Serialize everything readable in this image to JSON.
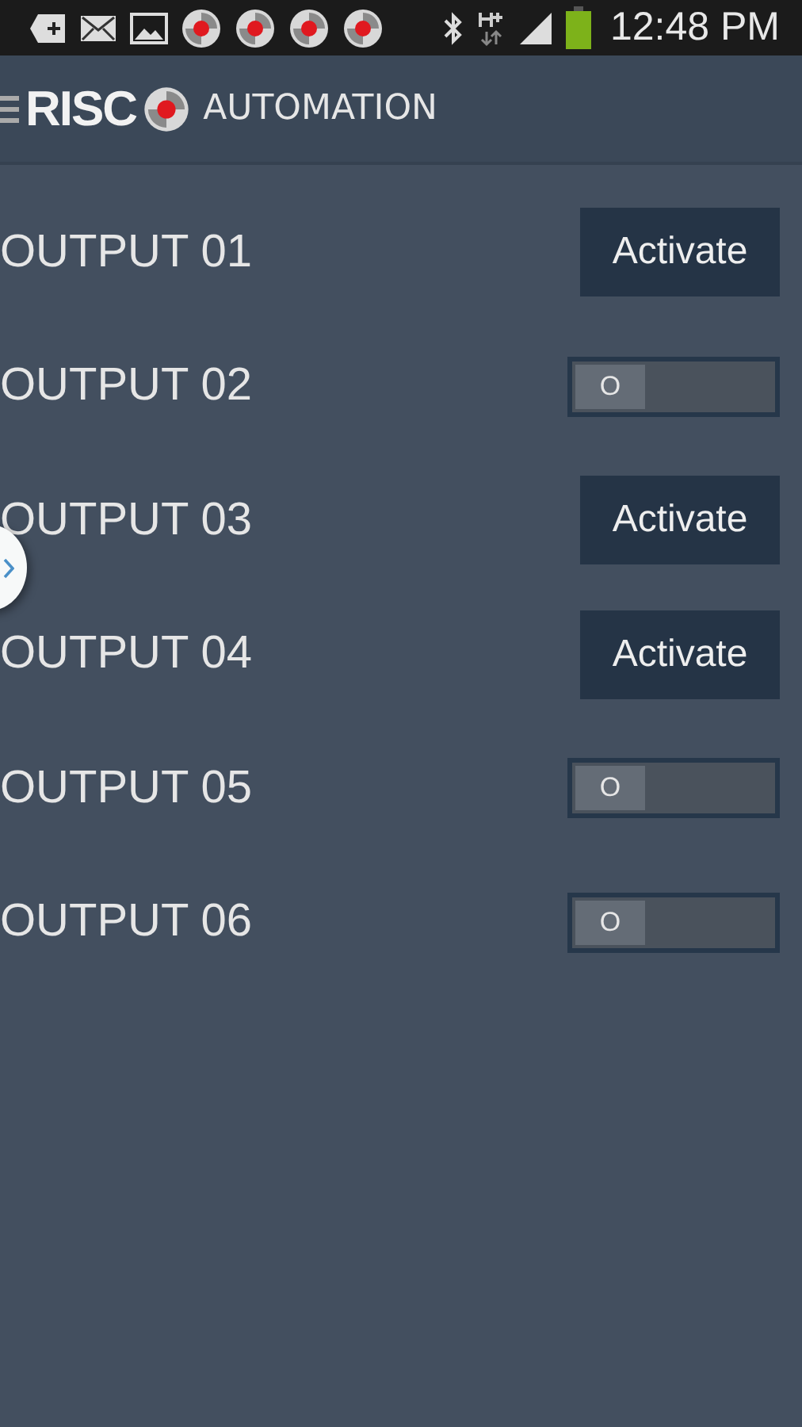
{
  "status_bar": {
    "time": "12:48 PM"
  },
  "app_bar": {
    "logo_text": "RISC",
    "title": "AUTOMATION"
  },
  "outputs": [
    {
      "name": "OUTPUT 01",
      "kind": "button",
      "action": "Activate"
    },
    {
      "name": "OUTPUT 02",
      "kind": "toggle",
      "on": false,
      "label": "O"
    },
    {
      "name": "OUTPUT 03",
      "kind": "button",
      "action": "Activate"
    },
    {
      "name": "OUTPUT 04",
      "kind": "button",
      "action": "Activate"
    },
    {
      "name": "OUTPUT 05",
      "kind": "toggle",
      "on": false,
      "label": "O"
    },
    {
      "name": "OUTPUT 06",
      "kind": "toggle",
      "on": false,
      "label": "O"
    }
  ]
}
